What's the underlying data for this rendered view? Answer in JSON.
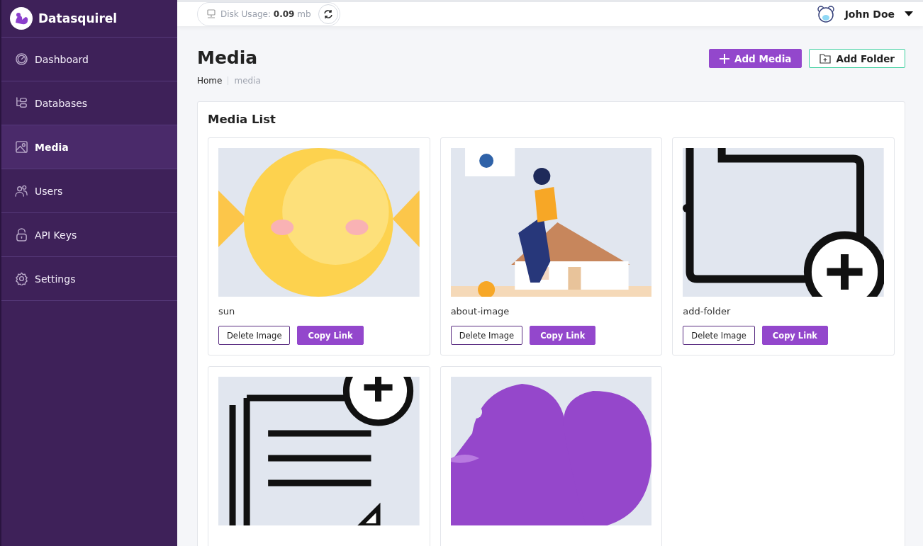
{
  "brand": "Datasquirel",
  "sidebar": {
    "items": [
      {
        "label": "Dashboard",
        "selected": false
      },
      {
        "label": "Databases",
        "selected": false
      },
      {
        "label": "Media",
        "selected": true
      },
      {
        "label": "Users",
        "selected": false
      },
      {
        "label": "API Keys",
        "selected": false
      },
      {
        "label": "Settings",
        "selected": false
      }
    ]
  },
  "header": {
    "disk_usage_label": "Disk Usage:",
    "disk_usage_value": "0.09",
    "disk_usage_unit": "mb",
    "user_name": "John Doe"
  },
  "page": {
    "title": "Media",
    "breadcrumb": [
      "Home",
      "media"
    ],
    "actions": [
      "Add Media",
      "Add Folder"
    ]
  },
  "media_list": {
    "title": "Media List",
    "items": [
      {
        "kind": "picture",
        "name": "sun",
        "buttons": [
          "Delete Image",
          "Copy Link"
        ]
      },
      {
        "kind": "picture",
        "name": "about-image",
        "buttons": [
          "Delete Image",
          "Copy Link"
        ]
      },
      {
        "kind": "picture",
        "name": "add-folder",
        "buttons": [
          "Delete Image",
          "Copy Link"
        ]
      },
      {
        "kind": "picture"
      },
      {
        "kind": "picture"
      }
    ]
  }
}
